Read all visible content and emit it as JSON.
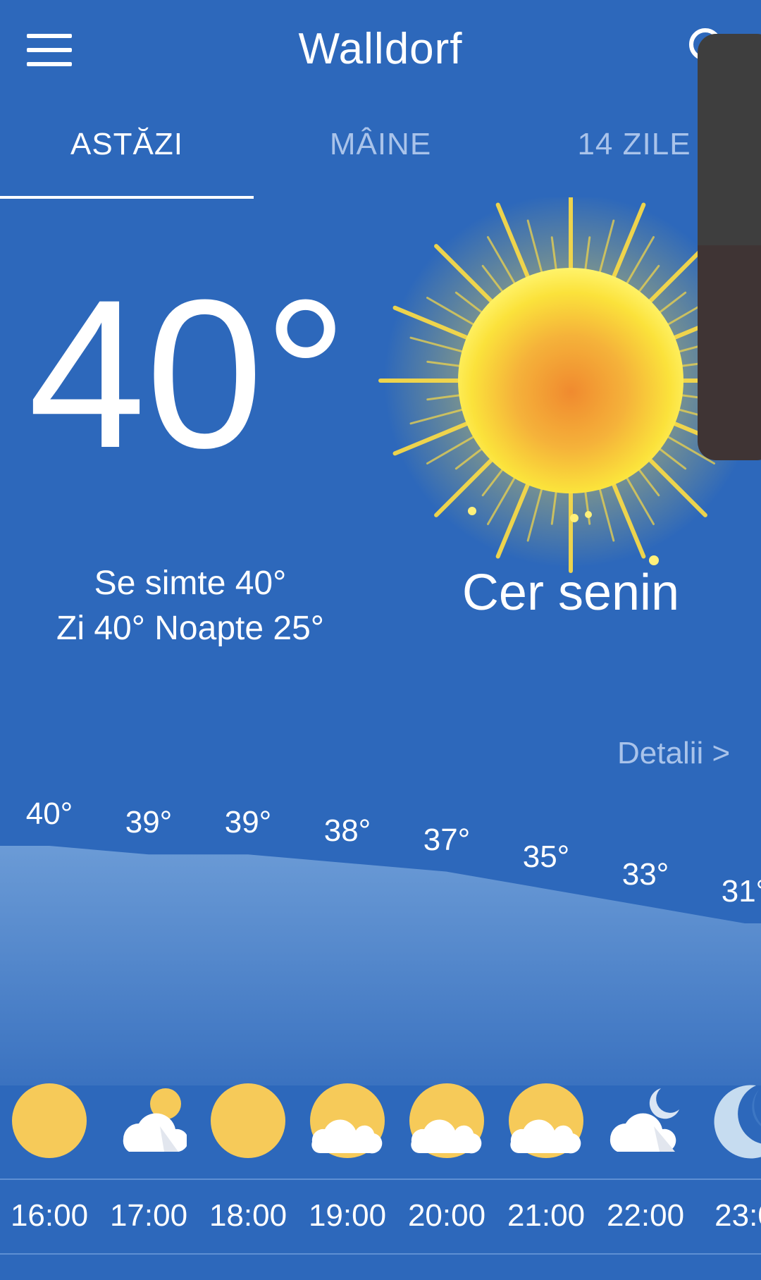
{
  "header": {
    "title": "Walldorf",
    "menu_icon": "hamburger-icon",
    "search_icon": "search-icon"
  },
  "tabs": [
    {
      "label": "ASTĂZI",
      "active": true
    },
    {
      "label": "MÂINE",
      "active": false
    },
    {
      "label": "14 ZILE",
      "active": false
    }
  ],
  "current": {
    "temperature": "40°",
    "feels_like": "Se simte 40°",
    "day_night": "Zi 40° Noapte 25°",
    "condition": "Cer senin"
  },
  "details_link": "Detalii >",
  "hourly": [
    {
      "time": "16:00",
      "temp": "40°",
      "icon": "sun-icon"
    },
    {
      "time": "17:00",
      "temp": "39°",
      "icon": "cloud-sun-icon"
    },
    {
      "time": "18:00",
      "temp": "39°",
      "icon": "sun-icon"
    },
    {
      "time": "19:00",
      "temp": "38°",
      "icon": "sun-cloud-icon"
    },
    {
      "time": "20:00",
      "temp": "37°",
      "icon": "sun-cloud-icon"
    },
    {
      "time": "21:00",
      "temp": "35°",
      "icon": "sun-cloud-icon"
    },
    {
      "time": "22:00",
      "temp": "33°",
      "icon": "cloud-moon-icon"
    },
    {
      "time": "23:0",
      "temp": "31°",
      "icon": "moon-icon"
    }
  ],
  "colors": {
    "background": "#2d68bb",
    "area_fill": "#5a8fd0",
    "sun": "#f6ca59",
    "tab_inactive": "#a9c3ea"
  }
}
